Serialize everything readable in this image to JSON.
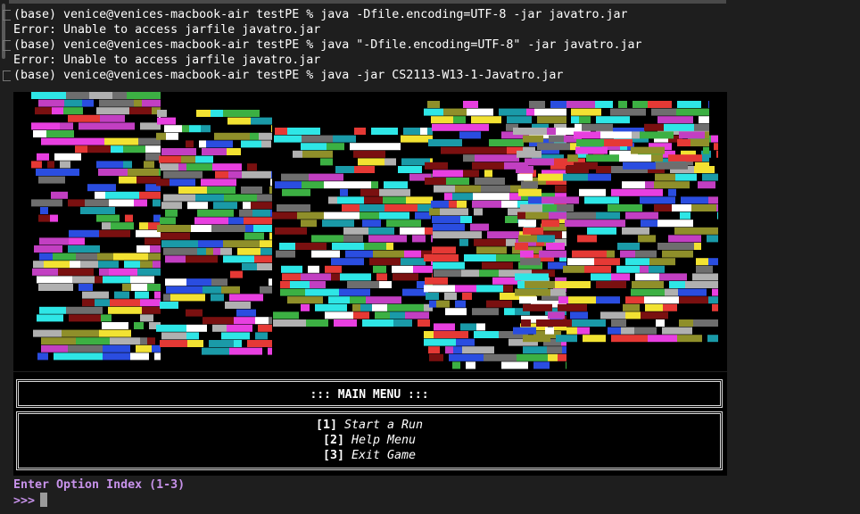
{
  "terminal": {
    "lines": [
      "(base) venice@venices-macbook-air testPE % java -Dfile.encoding=UTF-8 -jar javatro.jar",
      "Error: Unable to access jarfile javatro.jar",
      "(base) venice@venices-macbook-air testPE % java \"-Dfile.encoding=UTF-8\" -jar javatro.jar",
      "Error: Unable to access jarfile javatro.jar",
      "(base) venice@venices-macbook-air testPE % java -jar CS2113-W13-1-Javatro.jar"
    ]
  },
  "logo": {
    "name": "javatro-ascii-logo",
    "colors": [
      "#ffffff",
      "#e53935",
      "#2ee6e6",
      "#e83fe0",
      "#f2e232",
      "#2a4de0",
      "#3cb043",
      "#8f8f2a",
      "#b0b0b0",
      "#6e6e6e",
      "#1a9aa8",
      "#c23fc2",
      "#7a1010"
    ]
  },
  "menu": {
    "title": "::: MAIN MENU :::",
    "options": [
      {
        "index": "[1]",
        "label": "Start a Run"
      },
      {
        "index": "[2]",
        "label": "Help Menu"
      },
      {
        "index": "[3]",
        "label": "Exit Game"
      }
    ]
  },
  "prompt": {
    "question": "Enter Option Index (1-3)",
    "symbol": ">>>",
    "accent_color": "#c792ea"
  }
}
